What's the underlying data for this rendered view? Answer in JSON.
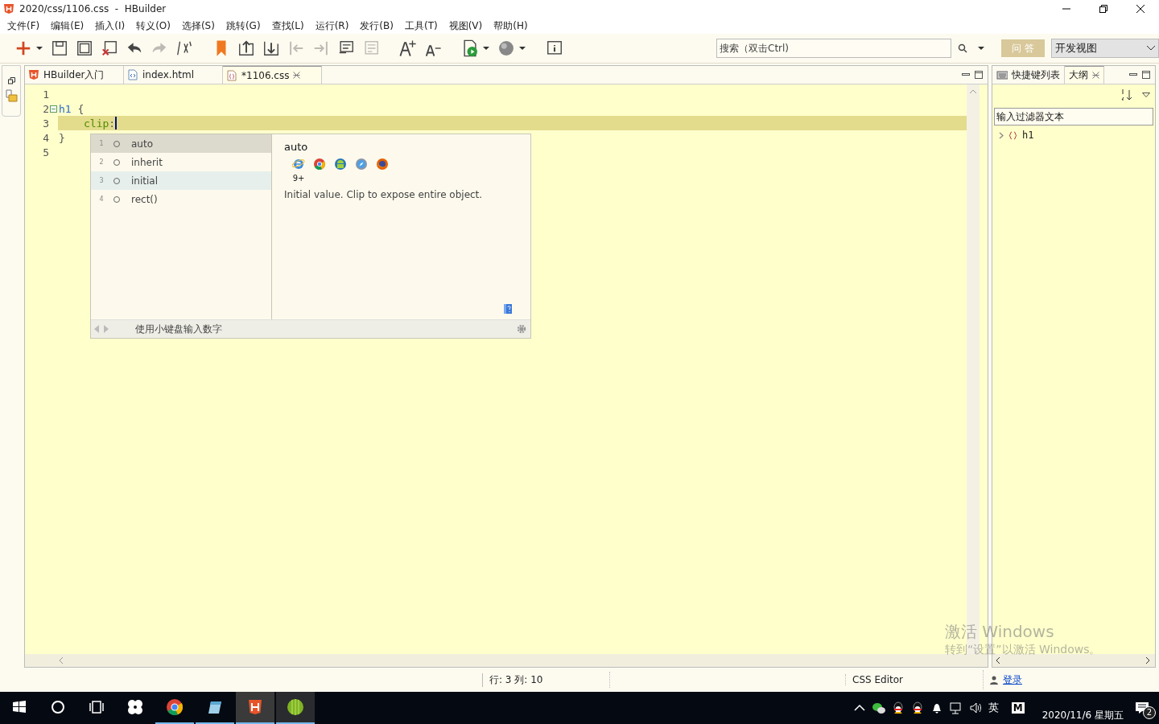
{
  "window": {
    "title": "2020/css/1106.css  -  HBuilder"
  },
  "menu": [
    "文件(F)",
    "编辑(E)",
    "插入(I)",
    "转义(O)",
    "选择(S)",
    "跳转(G)",
    "查找(L)",
    "运行(R)",
    "发行(B)",
    "工具(T)",
    "视图(V)",
    "帮助(H)"
  ],
  "toolbar": [
    {
      "kind": "new",
      "disabled": false
    },
    {
      "kind": "dropdown",
      "disabled": false
    },
    {
      "kind": "save",
      "disabled": false
    },
    {
      "kind": "save-all",
      "disabled": false
    },
    {
      "kind": "close-file",
      "disabled": false
    },
    {
      "kind": "undo",
      "disabled": false
    },
    {
      "kind": "redo",
      "disabled": true
    },
    {
      "kind": "format",
      "disabled": false
    },
    {
      "kind": "bookmark",
      "disabled": false
    },
    {
      "kind": "up-file",
      "disabled": false
    },
    {
      "kind": "down-file",
      "disabled": false
    },
    {
      "kind": "outdent",
      "disabled": true
    },
    {
      "kind": "indent",
      "disabled": true
    },
    {
      "kind": "comment",
      "disabled": false
    },
    {
      "kind": "uncomment",
      "disabled": true
    },
    {
      "kind": "font-bigger",
      "disabled": false
    },
    {
      "kind": "font-smaller",
      "disabled": false
    },
    {
      "kind": "run",
      "disabled": false
    },
    {
      "kind": "dropdown",
      "disabled": false
    },
    {
      "kind": "browser",
      "disabled": false
    },
    {
      "kind": "dropdown",
      "disabled": false
    },
    {
      "kind": "info",
      "disabled": false
    }
  ],
  "search": {
    "placeholder": "搜索（双击Ctrl)"
  },
  "qa_button": "问 答",
  "perspective": {
    "value": "开发视图"
  },
  "editor_tabs": [
    {
      "label": "HBuilder入门",
      "kind": "hbuilder",
      "selected": false,
      "closable": false
    },
    {
      "label": "index.html",
      "kind": "html",
      "selected": false,
      "closable": false
    },
    {
      "label": "*1106.css",
      "kind": "css",
      "selected": true,
      "closable": true
    }
  ],
  "code_lines": [
    {
      "number": "1",
      "foldable": false,
      "current": false
    },
    {
      "number": "2",
      "foldable": true,
      "current": false,
      "indented": false,
      "tokens": [
        {
          "kind": "selector",
          "text": "h1"
        },
        {
          "kind": "punct",
          "text": " {"
        }
      ]
    },
    {
      "number": "3",
      "foldable": false,
      "current": true,
      "indented": true,
      "tokens": [
        {
          "kind": "property",
          "text": "clip"
        },
        {
          "kind": "punct",
          "text": ":"
        }
      ]
    },
    {
      "number": "4",
      "foldable": false,
      "current": false,
      "indented": false,
      "tokens": [
        {
          "kind": "punct",
          "text": "}"
        }
      ]
    },
    {
      "number": "5",
      "foldable": false,
      "current": false
    }
  ],
  "autocomplete": {
    "items": [
      {
        "index": "1",
        "label": "auto",
        "selected": true,
        "hovered": false
      },
      {
        "index": "2",
        "label": "inherit",
        "selected": false,
        "hovered": false
      },
      {
        "index": "3",
        "label": "initial",
        "selected": false,
        "hovered": true
      },
      {
        "index": "4",
        "label": "rect()",
        "selected": false,
        "hovered": false
      }
    ],
    "detail": {
      "title": "auto",
      "browsers": [
        {
          "kind": "ie",
          "version": "9+"
        },
        {
          "kind": "chrome"
        },
        {
          "kind": "android"
        },
        {
          "kind": "safari"
        },
        {
          "kind": "firefox"
        }
      ],
      "description": "Initial value. Clip to expose entire object."
    },
    "hint": "使用小键盘输入数字"
  },
  "side_tabs": [
    {
      "label": "快捷键列表",
      "kind": "keyboard",
      "selected": false,
      "closable": false
    },
    {
      "label": "大纲",
      "kind": "outline",
      "selected": true,
      "closable": true
    }
  ],
  "outline_filter": {
    "placeholder": "输入过滤器文本"
  },
  "outline_tree": [
    {
      "label": "h1",
      "expanded": false
    }
  ],
  "status_bar": {
    "position": "行: 3 列: 10",
    "editor": "CSS Editor",
    "login": "登录"
  },
  "activation": {
    "title": "激活 Windows",
    "text": "转到“设置”以激活 Windows。"
  },
  "taskbar": {
    "apps": [
      {
        "kind": "start",
        "running": false,
        "active": false
      },
      {
        "kind": "search",
        "running": false,
        "active": false
      },
      {
        "kind": "task-view",
        "running": false,
        "active": false
      },
      {
        "kind": "pinwheel",
        "running": false,
        "active": false
      },
      {
        "kind": "chrome",
        "running": true,
        "active": false
      },
      {
        "kind": "notepad",
        "running": true,
        "active": false
      },
      {
        "kind": "hbuilder",
        "running": true,
        "active": true
      },
      {
        "kind": "striped-ball",
        "running": true,
        "active": false
      }
    ],
    "tray": [
      {
        "kind": "chevron"
      },
      {
        "kind": "chat"
      },
      {
        "kind": "penguin"
      },
      {
        "kind": "penguin"
      },
      {
        "kind": "bell"
      },
      {
        "kind": "network"
      },
      {
        "kind": "volume"
      }
    ],
    "ime": "英",
    "ime_mode": "M",
    "date": "2020/11/6 星期五",
    "notifications": "2"
  }
}
